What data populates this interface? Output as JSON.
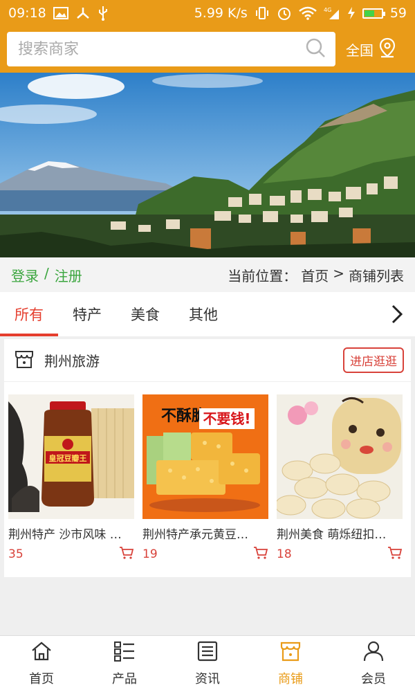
{
  "status_bar": {
    "time": "09:18",
    "speed": "5.99 K/s",
    "network": "4G",
    "battery": "59",
    "battery_level": 0.59,
    "icons": [
      "image-icon",
      "usb-debug-icon",
      "usb-icon",
      "vibrate-icon",
      "alarm-icon",
      "wifi-icon",
      "signal-icon",
      "charging-icon",
      "battery-icon"
    ]
  },
  "search": {
    "placeholder": "搜索商家",
    "region_label": "全国"
  },
  "banner": {
    "description": "coastal town with mountains banner"
  },
  "info_row": {
    "login": "登录",
    "separator": "/",
    "register": "注册",
    "location_label": "当前位置：",
    "crumb_home": "首页",
    "crumb_sep": ">",
    "crumb_current": "商铺列表"
  },
  "tabs": [
    {
      "label": "所有",
      "active": true
    },
    {
      "label": "特产",
      "active": false
    },
    {
      "label": "美食",
      "active": false
    },
    {
      "label": "其他",
      "active": false
    }
  ],
  "shop": {
    "name": "荆州旅游",
    "enter_label": "进店逛逛",
    "products": [
      {
        "name": "荆州特产 沙市风味 …",
        "price": "35"
      },
      {
        "name": "荆州特产承元黄豆…",
        "price": "19"
      },
      {
        "name": "荆州美食 萌烁纽扣…",
        "price": "18"
      }
    ]
  },
  "product_images": [
    {
      "text_line1": "皇冠豆瓣王"
    },
    {
      "text_line1": "不酥脆",
      "text_line2": "不要钱!"
    },
    {}
  ],
  "bottom_nav": [
    {
      "label": "首页",
      "icon": "home-icon",
      "active": false
    },
    {
      "label": "产品",
      "icon": "list-icon",
      "active": false
    },
    {
      "label": "资讯",
      "icon": "news-icon",
      "active": false
    },
    {
      "label": "商铺",
      "icon": "shop-icon",
      "active": true
    },
    {
      "label": "会员",
      "icon": "user-icon",
      "active": false
    }
  ],
  "colors": {
    "brand": "#e99b18",
    "accent_red": "#e53e2e",
    "login_green": "#3aa53e"
  }
}
